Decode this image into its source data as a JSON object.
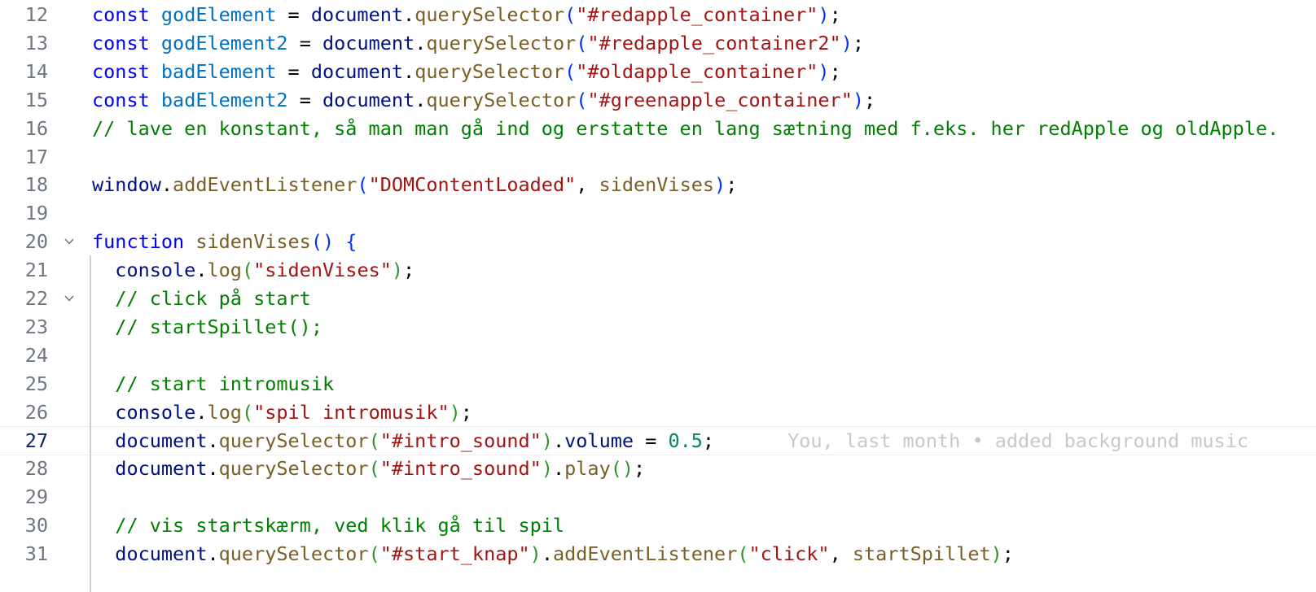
{
  "editor": {
    "lines": [
      {
        "number": "12",
        "tokens": [
          {
            "t": "const",
            "c": "kw"
          },
          {
            "t": " "
          },
          {
            "t": "godElement",
            "c": "var"
          },
          {
            "t": " = "
          },
          {
            "t": "document",
            "c": "id"
          },
          {
            "t": "."
          },
          {
            "t": "querySelector",
            "c": "fn"
          },
          {
            "t": "(",
            "c": "b1"
          },
          {
            "t": "\"#redapple_container\"",
            "c": "str"
          },
          {
            "t": ")",
            "c": "b1"
          },
          {
            "t": ";"
          }
        ]
      },
      {
        "number": "13",
        "tokens": [
          {
            "t": "const",
            "c": "kw"
          },
          {
            "t": " "
          },
          {
            "t": "godElement2",
            "c": "var"
          },
          {
            "t": " = "
          },
          {
            "t": "document",
            "c": "id"
          },
          {
            "t": "."
          },
          {
            "t": "querySelector",
            "c": "fn"
          },
          {
            "t": "(",
            "c": "b1"
          },
          {
            "t": "\"#redapple_container2\"",
            "c": "str"
          },
          {
            "t": ")",
            "c": "b1"
          },
          {
            "t": ";"
          }
        ]
      },
      {
        "number": "14",
        "tokens": [
          {
            "t": "const",
            "c": "kw"
          },
          {
            "t": " "
          },
          {
            "t": "badElement",
            "c": "var"
          },
          {
            "t": " = "
          },
          {
            "t": "document",
            "c": "id"
          },
          {
            "t": "."
          },
          {
            "t": "querySelector",
            "c": "fn"
          },
          {
            "t": "(",
            "c": "b1"
          },
          {
            "t": "\"#oldapple_container\"",
            "c": "str"
          },
          {
            "t": ")",
            "c": "b1"
          },
          {
            "t": ";"
          }
        ]
      },
      {
        "number": "15",
        "tokens": [
          {
            "t": "const",
            "c": "kw"
          },
          {
            "t": " "
          },
          {
            "t": "badElement2",
            "c": "var"
          },
          {
            "t": " = "
          },
          {
            "t": "document",
            "c": "id"
          },
          {
            "t": "."
          },
          {
            "t": "querySelector",
            "c": "fn"
          },
          {
            "t": "(",
            "c": "b1"
          },
          {
            "t": "\"#greenapple_container\"",
            "c": "str"
          },
          {
            "t": ")",
            "c": "b1"
          },
          {
            "t": ";"
          }
        ]
      },
      {
        "number": "16",
        "tokens": [
          {
            "t": "// lave en konstant, så man man gå ind og erstatte en lang sætning med f.eks. her redApple og oldApple. ",
            "c": "cm"
          }
        ]
      },
      {
        "number": "17",
        "tokens": []
      },
      {
        "number": "18",
        "tokens": [
          {
            "t": "window",
            "c": "id"
          },
          {
            "t": "."
          },
          {
            "t": "addEventListener",
            "c": "fn"
          },
          {
            "t": "(",
            "c": "b1"
          },
          {
            "t": "\"DOMContentLoaded\"",
            "c": "str"
          },
          {
            "t": ", "
          },
          {
            "t": "sidenVises",
            "c": "fn"
          },
          {
            "t": ")",
            "c": "b1"
          },
          {
            "t": ";"
          }
        ]
      },
      {
        "number": "19",
        "tokens": []
      },
      {
        "number": "20",
        "fold": true,
        "tokens": [
          {
            "t": "function",
            "c": "kw"
          },
          {
            "t": " "
          },
          {
            "t": "sidenVises",
            "c": "fn"
          },
          {
            "t": "()",
            "c": "b1"
          },
          {
            "t": " "
          },
          {
            "t": "{",
            "c": "b1"
          }
        ]
      },
      {
        "number": "21",
        "tokens": [
          {
            "t": "  "
          },
          {
            "t": "console",
            "c": "id"
          },
          {
            "t": "."
          },
          {
            "t": "log",
            "c": "fn"
          },
          {
            "t": "(",
            "c": "b2"
          },
          {
            "t": "\"sidenVises\"",
            "c": "str"
          },
          {
            "t": ")",
            "c": "b2"
          },
          {
            "t": ";"
          }
        ]
      },
      {
        "number": "22",
        "fold": true,
        "tokens": [
          {
            "t": "  "
          },
          {
            "t": "// click på start",
            "c": "cm"
          }
        ]
      },
      {
        "number": "23",
        "tokens": [
          {
            "t": "  "
          },
          {
            "t": "// startSpillet();",
            "c": "cm"
          }
        ]
      },
      {
        "number": "24",
        "tokens": []
      },
      {
        "number": "25",
        "tokens": [
          {
            "t": "  "
          },
          {
            "t": "// start intromusik",
            "c": "cm"
          }
        ]
      },
      {
        "number": "26",
        "tokens": [
          {
            "t": "  "
          },
          {
            "t": "console",
            "c": "id"
          },
          {
            "t": "."
          },
          {
            "t": "log",
            "c": "fn"
          },
          {
            "t": "(",
            "c": "b2"
          },
          {
            "t": "\"spil intromusik\"",
            "c": "str"
          },
          {
            "t": ")",
            "c": "b2"
          },
          {
            "t": ";"
          }
        ]
      },
      {
        "number": "27",
        "current": true,
        "blame": "You, last month • added background music",
        "tokens": [
          {
            "t": "  "
          },
          {
            "t": "document",
            "c": "id"
          },
          {
            "t": "."
          },
          {
            "t": "querySelector",
            "c": "fn"
          },
          {
            "t": "(",
            "c": "b2"
          },
          {
            "t": "\"#intro_sound\"",
            "c": "str"
          },
          {
            "t": ")",
            "c": "b2"
          },
          {
            "t": "."
          },
          {
            "t": "volume",
            "c": "id"
          },
          {
            "t": " = "
          },
          {
            "t": "0.5",
            "c": "num"
          },
          {
            "t": ";"
          }
        ]
      },
      {
        "number": "28",
        "tokens": [
          {
            "t": "  "
          },
          {
            "t": "document",
            "c": "id"
          },
          {
            "t": "."
          },
          {
            "t": "querySelector",
            "c": "fn"
          },
          {
            "t": "(",
            "c": "b2"
          },
          {
            "t": "\"#intro_sound\"",
            "c": "str"
          },
          {
            "t": ")",
            "c": "b2"
          },
          {
            "t": "."
          },
          {
            "t": "play",
            "c": "fn"
          },
          {
            "t": "()",
            "c": "b2"
          },
          {
            "t": ";"
          }
        ]
      },
      {
        "number": "29",
        "tokens": []
      },
      {
        "number": "30",
        "tokens": [
          {
            "t": "  "
          },
          {
            "t": "// vis startskærm, ved klik gå til spil",
            "c": "cm"
          }
        ]
      },
      {
        "number": "31",
        "tokens": [
          {
            "t": "  "
          },
          {
            "t": "document",
            "c": "id"
          },
          {
            "t": "."
          },
          {
            "t": "querySelector",
            "c": "fn"
          },
          {
            "t": "(",
            "c": "b2"
          },
          {
            "t": "\"#start_knap\"",
            "c": "str"
          },
          {
            "t": ")",
            "c": "b2"
          },
          {
            "t": "."
          },
          {
            "t": "addEventListener",
            "c": "fn"
          },
          {
            "t": "(",
            "c": "b2"
          },
          {
            "t": "\"click\"",
            "c": "str"
          },
          {
            "t": ", "
          },
          {
            "t": "startSpillet",
            "c": "fn"
          },
          {
            "t": ")",
            "c": "b2"
          },
          {
            "t": ";"
          }
        ]
      }
    ],
    "fold_icon": "chevron-down-icon"
  }
}
